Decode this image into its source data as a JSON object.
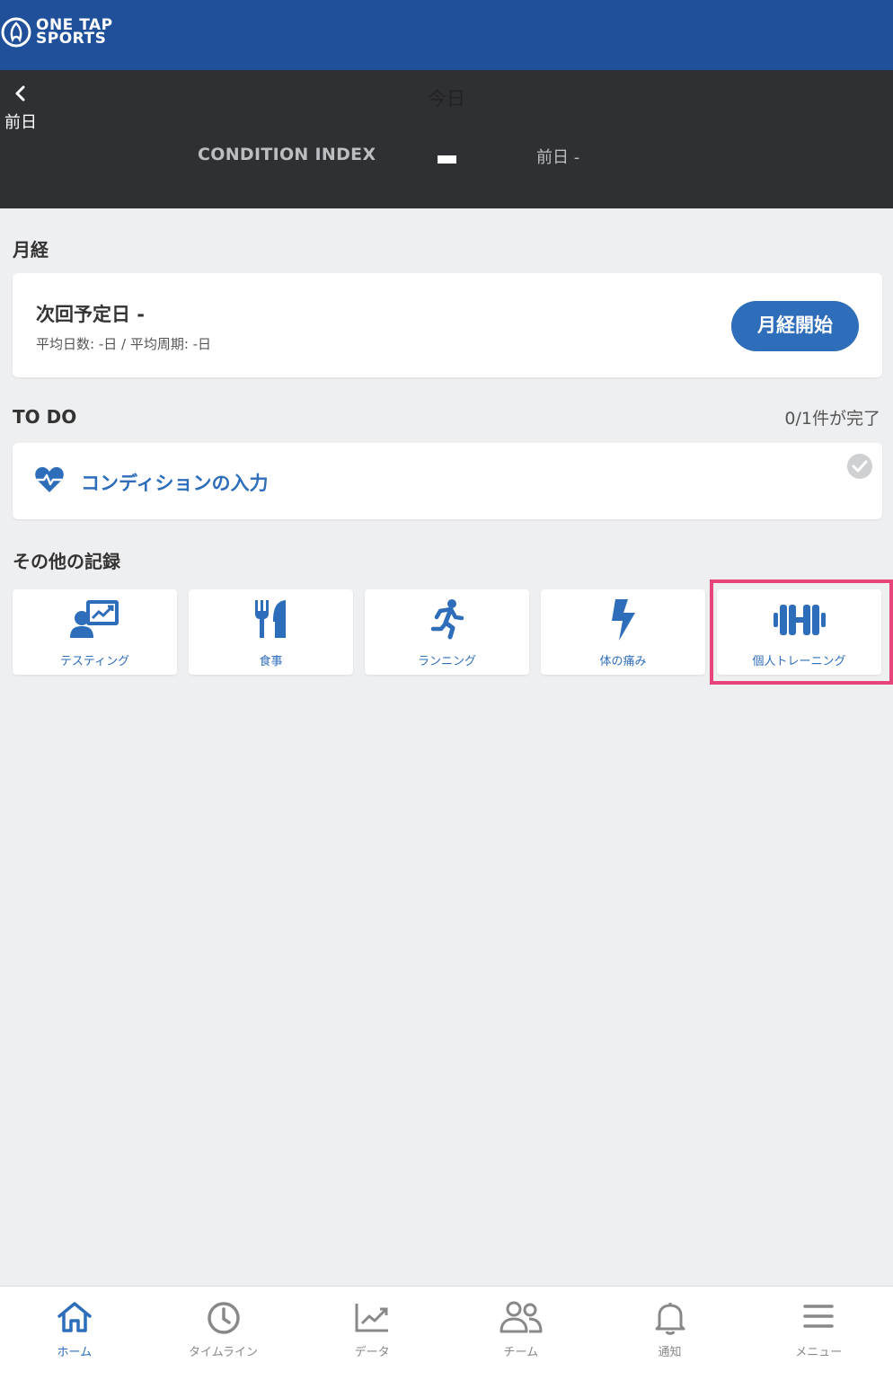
{
  "brand": {
    "logo_line1": "ONE TAP",
    "logo_line2": "SPORTS"
  },
  "date_nav": {
    "back_label": "前日",
    "title": "今日",
    "condition_index_label": "CONDITION INDEX",
    "condition_index_value": "",
    "previous_day": "前日 -"
  },
  "menstruation": {
    "section_title": "月経",
    "next_date": "次回予定日 -",
    "cycle_info": "平均日数: -日  /  平均周期: -日",
    "start_button": "月経開始"
  },
  "todo": {
    "section_title": "TO DO",
    "progress": "0/1件が完了",
    "items": [
      {
        "label": "コンディションの入力",
        "icon": "heart-pulse-icon",
        "done": false
      }
    ]
  },
  "other_records": {
    "section_title": "その他の記録",
    "tiles": [
      {
        "label": "テスティング",
        "icon": "testing-icon"
      },
      {
        "label": "食事",
        "icon": "utensils-icon"
      },
      {
        "label": "ランニング",
        "icon": "running-icon"
      },
      {
        "label": "体の痛み",
        "icon": "bolt-icon"
      },
      {
        "label": "個人トレーニング",
        "icon": "dumbbell-icon",
        "highlighted": true
      }
    ]
  },
  "bottom_nav": {
    "items": [
      {
        "label": "ホーム",
        "icon": "home-icon",
        "active": true
      },
      {
        "label": "タイムライン",
        "icon": "clock-icon"
      },
      {
        "label": "データ",
        "icon": "chart-icon"
      },
      {
        "label": "チーム",
        "icon": "team-icon"
      },
      {
        "label": "通知",
        "icon": "bell-icon"
      },
      {
        "label": "メニュー",
        "icon": "menu-icon"
      }
    ]
  },
  "colors": {
    "header": "#20509a",
    "date_bar": "#2f3033",
    "accent": "#2d6dba",
    "background": "#eeeff1",
    "highlight": "#e8457a"
  }
}
